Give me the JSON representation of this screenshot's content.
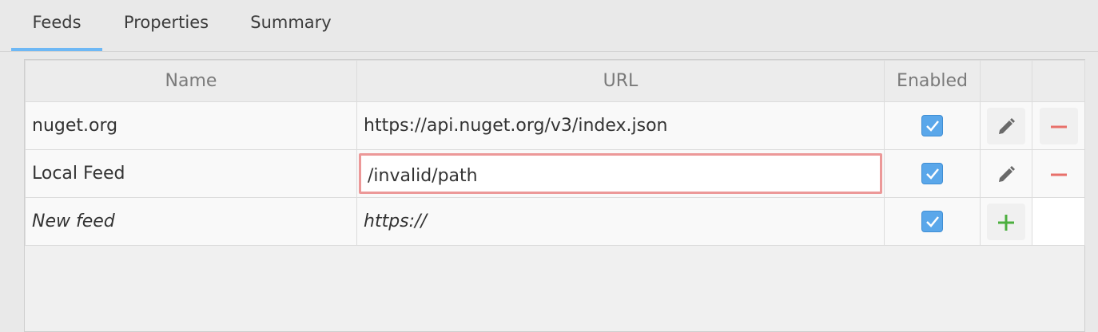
{
  "tabs": [
    {
      "label": "Feeds",
      "active": true
    },
    {
      "label": "Properties",
      "active": false
    },
    {
      "label": "Summary",
      "active": false
    }
  ],
  "table": {
    "headers": {
      "name": "Name",
      "url": "URL",
      "enabled": "Enabled"
    },
    "rows": [
      {
        "name": "nuget.org",
        "url": "https://api.nuget.org/v3/index.json",
        "enabled": true
      },
      {
        "name": "Local Feed",
        "url": "/invalid/path",
        "enabled": true,
        "invalid": true
      },
      {
        "name": "New feed",
        "url": "https://",
        "enabled": true,
        "placeholder": true
      }
    ]
  },
  "icons": {
    "edit": "pencil-icon",
    "remove": "minus-icon",
    "add": "plus-icon",
    "check": "checkmark-icon"
  },
  "colors": {
    "tab_active_underline": "#6eb8f5",
    "checkbox": "#5aa7ea",
    "invalid_border": "#ec9898",
    "remove_icon": "#e8706a",
    "add_icon": "#4caf3f",
    "edit_icon": "#6a6a6a"
  }
}
